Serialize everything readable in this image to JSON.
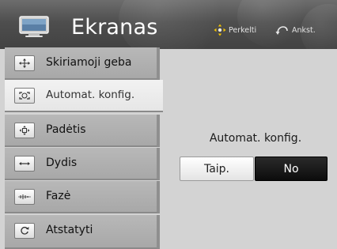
{
  "header": {
    "title": "Ekranas",
    "hint_move": "Perkelti",
    "hint_back": "Ankst."
  },
  "menu": {
    "items": [
      {
        "label": "Skiriamoji geba",
        "icon": "resolution-icon",
        "selected": false
      },
      {
        "label": "Automat. konfig.",
        "icon": "auto-config-icon",
        "selected": true
      },
      {
        "label": "Padėtis",
        "icon": "position-icon",
        "selected": false
      },
      {
        "label": "Dydis",
        "icon": "size-icon",
        "selected": false
      },
      {
        "label": "Fazė",
        "icon": "phase-icon",
        "selected": false
      },
      {
        "label": "Atstatyti",
        "icon": "reset-icon",
        "selected": false
      }
    ]
  },
  "dialog": {
    "title": "Automat. konfig.",
    "yes_label": "Taip.",
    "no_label": "No",
    "focused": "no"
  },
  "colors": {
    "header_bg": "#4e4e4e",
    "panel_bg": "#d3d3d3",
    "focused_button": "#111111"
  }
}
